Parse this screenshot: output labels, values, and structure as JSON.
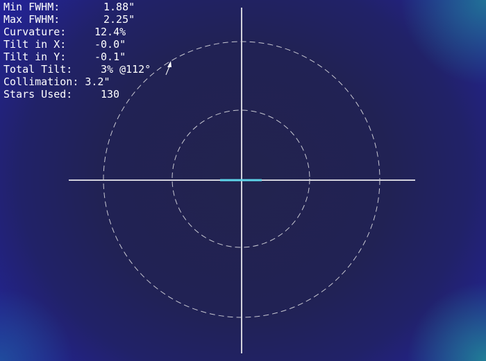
{
  "stats": [
    {
      "label": "Min FWHM:",
      "value": "1.88\""
    },
    {
      "label": "Max FWHM:",
      "value": "2.25\""
    },
    {
      "label": "Curvature:",
      "value": "12.4%"
    },
    {
      "label": "Tilt in X:",
      "value": "-0.0\""
    },
    {
      "label": "Tilt in Y:",
      "value": "-0.1\""
    },
    {
      "label": "Total Tilt:",
      "value": "3% @112°"
    },
    {
      "label": "Collimation:",
      "value": "3.2\""
    },
    {
      "label": "Stars Used:",
      "value": "130"
    }
  ],
  "colors": {
    "background_center": "#22234e",
    "background_edge": "#2421a9",
    "corner_glow": "#208c96",
    "crosshair": "#d2d2dc",
    "rings": "#c8c8d2",
    "highlight": "#5fd6ea",
    "text": "#ffffff"
  }
}
